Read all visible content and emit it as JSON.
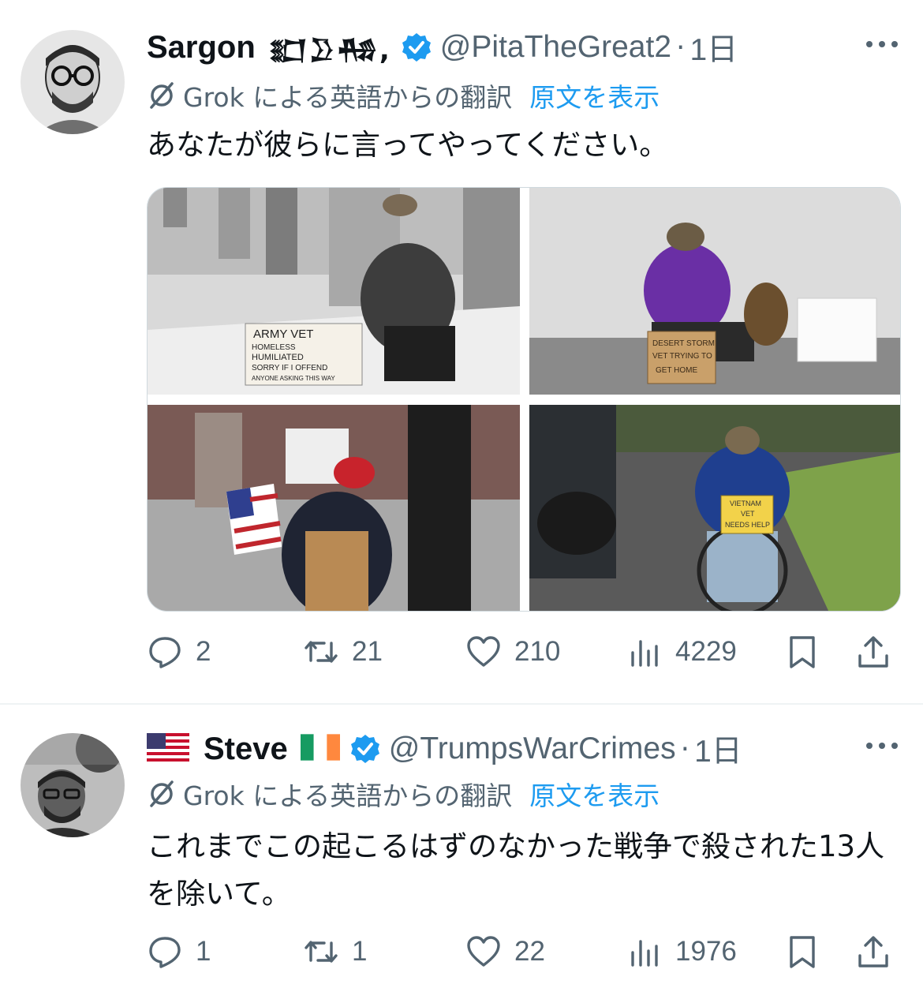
{
  "tweets": [
    {
      "display_name": "Sargon",
      "name_suffix": "𒊬𒊒𒄀,",
      "handle": "@PitaTheGreat2",
      "separator": "·",
      "time": "1日",
      "translation_label": "Grok による英語からの翻訳",
      "show_original_label": "原文を表示",
      "text": "あなたが彼らに言ってやってください。",
      "media": [
        {
          "alt_sign_lines": [
            "ARMY VET",
            "HOMELESS",
            "HUMILIATED",
            "SORRY IF I OFFEND",
            "ANYONE ASKING THIS WAY"
          ]
        },
        {
          "alt_sign_lines": [
            "DESERT STORM",
            "VET TRYING TO",
            "GET HOME"
          ]
        },
        {
          "alt_sign_lines": []
        },
        {
          "alt_sign_lines": [
            "VIETNAM",
            "VET",
            "NEEDS HELP"
          ]
        }
      ],
      "stats": {
        "replies": "2",
        "retweets": "21",
        "likes": "210",
        "views": "4229"
      }
    },
    {
      "flag_before": "🇺🇸",
      "display_name": "Steve",
      "flag_after": "🇮🇪",
      "handle": "@TrumpsWarCrimes",
      "separator": "·",
      "time": "1日",
      "translation_label": "Grok による英語からの翻訳",
      "show_original_label": "原文を表示",
      "text": "これまでこの起こるはずのなかった戦争で殺された13人を除いて。",
      "stats": {
        "replies": "1",
        "retweets": "1",
        "likes": "22",
        "views": "1976"
      }
    }
  ],
  "colors": {
    "accent": "#1d9bf0",
    "secondary_text": "#536471",
    "primary_text": "#0f1419"
  }
}
